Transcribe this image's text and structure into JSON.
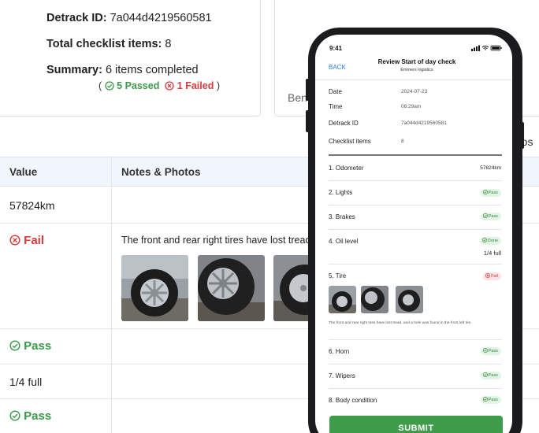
{
  "summary_card": {
    "detrack_label": "Detrack ID:",
    "detrack_value": "7a044d4219560581",
    "total_label": "Total checklist items:",
    "total_value": "8",
    "summary_label": "Summary:",
    "summary_value": "6 items completed",
    "passed_text": "5 Passed",
    "failed_text": "1 Failed",
    "paren_open": "(",
    "paren_close": ")"
  },
  "right_card": {
    "partial_text": "Ben"
  },
  "photos_fragment": "otos",
  "table": {
    "headers": {
      "value": "Value",
      "notes": "Notes & Photos"
    },
    "rows": [
      {
        "value": "57824km"
      },
      {
        "value": "Fail",
        "note": "The front and rear right tires have lost tread,"
      },
      {
        "value": "Pass"
      },
      {
        "value": "1/4 full"
      },
      {
        "value": "Pass"
      }
    ]
  },
  "phone": {
    "time": "9:41",
    "back": "BACK",
    "title": "Review Start of day check",
    "subtitle": "Emmers logistics",
    "meta": [
      {
        "label": "Date",
        "value": "2024-07-23"
      },
      {
        "label": "Time",
        "value": "08:29am"
      },
      {
        "label": "Detrack ID",
        "value": "7a044d4219560581"
      },
      {
        "label": "Checklist items",
        "value": "8"
      }
    ],
    "items": [
      {
        "label": "1. Odometer",
        "value": "57824km"
      },
      {
        "label": "2. Lights",
        "badge": "Pass"
      },
      {
        "label": "3. Brakes",
        "badge": "Pass"
      },
      {
        "label": "4. Oil level",
        "badge": "Done",
        "value": "1/4 full"
      },
      {
        "label": "5. Tire",
        "badge": "Fail"
      },
      {
        "label": "6. Horn",
        "badge": "Pass"
      },
      {
        "label": "7. Wipers",
        "badge": "Pass"
      },
      {
        "label": "8. Body condition",
        "badge": "Pass"
      }
    ],
    "tire_note": "The front and rear right tires have lost tread, and a hole was found in the front left tire.",
    "submit": "SUBMIT"
  },
  "colors": {
    "pass": "#3a9a4a",
    "fail": "#d63a3a",
    "accent": "#2f7be5",
    "submit": "#3f9c4a"
  }
}
